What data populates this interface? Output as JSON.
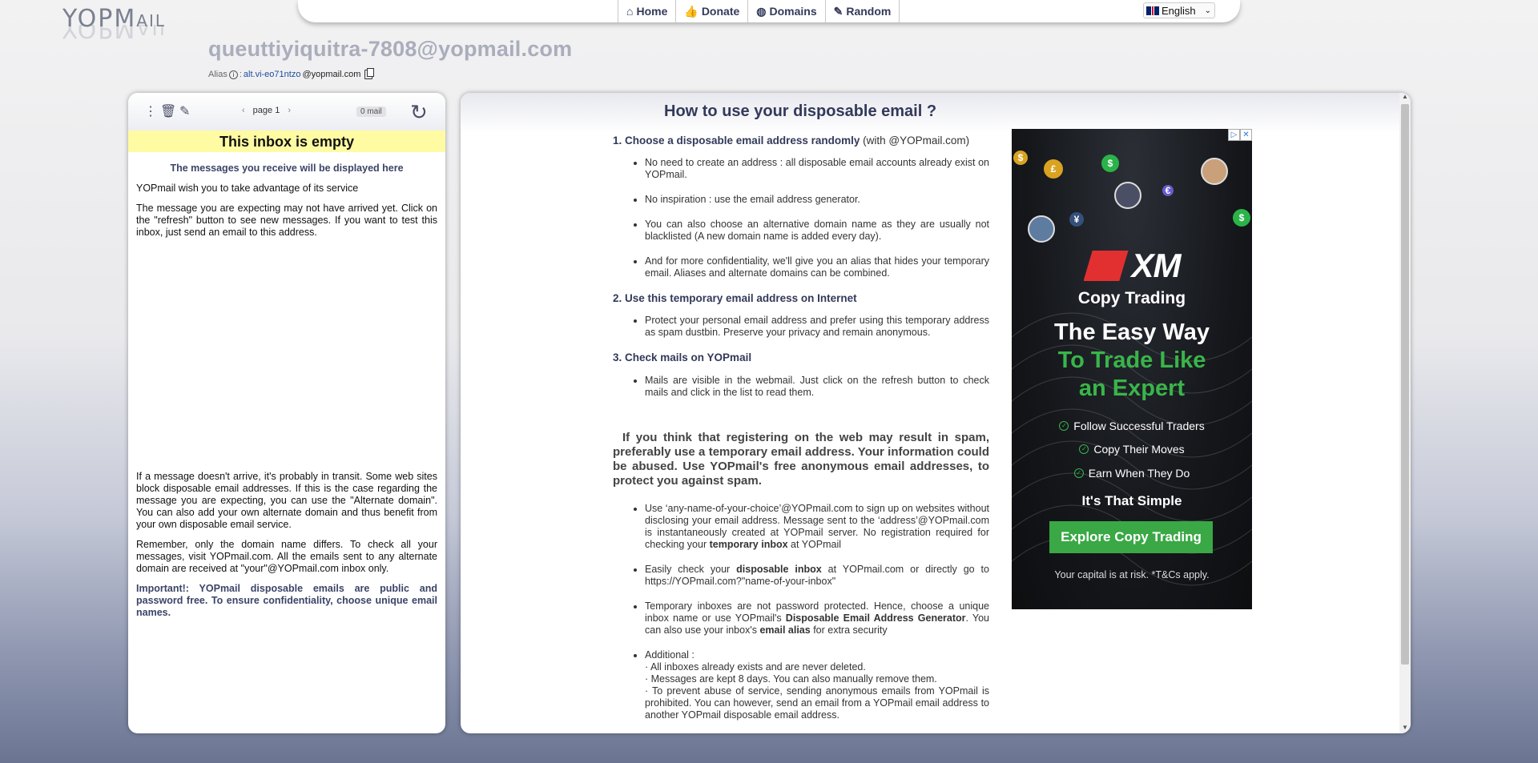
{
  "logo": {
    "text": "YOPMAIL",
    "main": "YOPM",
    "tail": "AIL"
  },
  "nav": {
    "items": [
      {
        "label": "Home",
        "icon": "home-icon",
        "glyph": "⌂"
      },
      {
        "label": "Donate",
        "icon": "thumbs-up-icon",
        "glyph": "👍"
      },
      {
        "label": "Domains",
        "icon": "globe-icon",
        "glyph": "◍"
      },
      {
        "label": "Random",
        "icon": "magic-wand-icon",
        "glyph": "✎"
      }
    ],
    "language": "English"
  },
  "address": "queuttiyiquitra-7808@yopmail.com",
  "alias": {
    "label": "Alias",
    "separator": ":",
    "value": "alt.vi-eo71ntzo",
    "domain": "@yopmail.com"
  },
  "inbox": {
    "page_label": "page 1",
    "mail_count": "0 mail",
    "empty_title": "This inbox is empty",
    "subtitle": "The messages you receive will be displayed here",
    "para1": "YOPmail wish you to take advantage of its service",
    "para2": "The message you are expecting may not have arrived yet. Click on the \"refresh\" button to see new messages. If you want to test this inbox, just send an email to this address.",
    "para3": "If a message doesn't arrive, it's probably in transit. Some web sites block disposable email addresses. If this is the case regarding the message you are expecting, you can use the \"Alternate domain\". You can also add your own alternate domain and thus benefit from your own disposable email service.",
    "para4": "Remember, only the domain name differs. To check all your messages, visit YOPmail.com. All the emails sent to any alternate domain are received at \"your\"@YOPmail.com inbox only.",
    "important": "Important!: YOPmail disposable emails are public and password free. To ensure confidentiality, choose unique email names."
  },
  "main": {
    "title": "How to use your disposable email ?",
    "s1_title": "1. Choose a disposable email address randomly",
    "s1_suffix": "(with @YOPmail.com)",
    "s1_items": [
      "No need to create an address : all disposable email accounts already exist on YOPmail.",
      "No inspiration : use the email address generator.",
      "You can also choose an alternative domain name as they are usually not blacklisted (A new domain name is added every day).",
      "And for more confidentiality, we'll give you an alias that hides your temporary email. Aliases and alternate domains can be combined."
    ],
    "s2_title": "2. Use this temporary email address on Internet",
    "s2_items": [
      "Protect your personal email address and prefer using this temporary address as spam dustbin. Preserve your privacy and remain anonymous."
    ],
    "s3_title": "3. Check mails on YOPmail",
    "s3_items": [
      "Mails are visible in the webmail. Just click on the refresh button to check mails and click in the list to read them."
    ],
    "big_para": "If you think that registering on the web may result in spam, preferably use a temporary email address. Your information could be abused. Use YOPmail's free anonymous email addresses, to protect you against spam.",
    "b1_pre": "Use ‘any-name-of-your-choice’@YOPmail.com to sign up on websites without disclosing your email address. Message sent to the ‘address’@YOPmail.com is instantaneously created at YOPmail server. No registration required for checking your",
    "b1_bold": "temporary inbox",
    "b1_post": "at YOPmail",
    "b2_pre": "Easily check your",
    "b2_bold": "disposable inbox",
    "b2_post": "at YOPmail.com or directly go to https://YOPmail.com?\"name-of-your-inbox\"",
    "b3_pre": "Temporary inboxes are not password protected. Hence, choose a unique inbox name or use YOPmail's",
    "b3_bold": "Disposable Email Address Generator",
    "b3_mid": ". You can also use your inbox's",
    "b3_bold2": "email alias",
    "b3_post": "for extra security",
    "b4_title": "Additional :",
    "b4_lines": "· All inboxes already exists and are never deleted.\n· Messages are kept 8 days. You can also manually remove them.\n· To prevent abuse of service, sending anonymous emails from YOPmail is prohibited. You can however, send an email from a YOPmail email address to another YOPmail disposable email address."
  },
  "ad": {
    "brand": "XM",
    "subtitle": "Copy Trading",
    "headline1": "The Easy Way",
    "headline2": "To Trade Like",
    "headline3": "an Expert",
    "checks": [
      "Follow Successful Traders",
      "Copy Their Moves",
      "Earn When They Do"
    ],
    "simple": "It's That Simple",
    "cta": "Explore Copy Trading",
    "risk": "Your capital is at risk. *T&Cs apply.",
    "coins": [
      "$",
      "£",
      "$",
      "¥",
      "$",
      "€"
    ]
  },
  "colors": {
    "accent": "#33395a",
    "banner": "#fffba3",
    "ad_green": "#39b54a",
    "ad_cta": "#39a845"
  }
}
